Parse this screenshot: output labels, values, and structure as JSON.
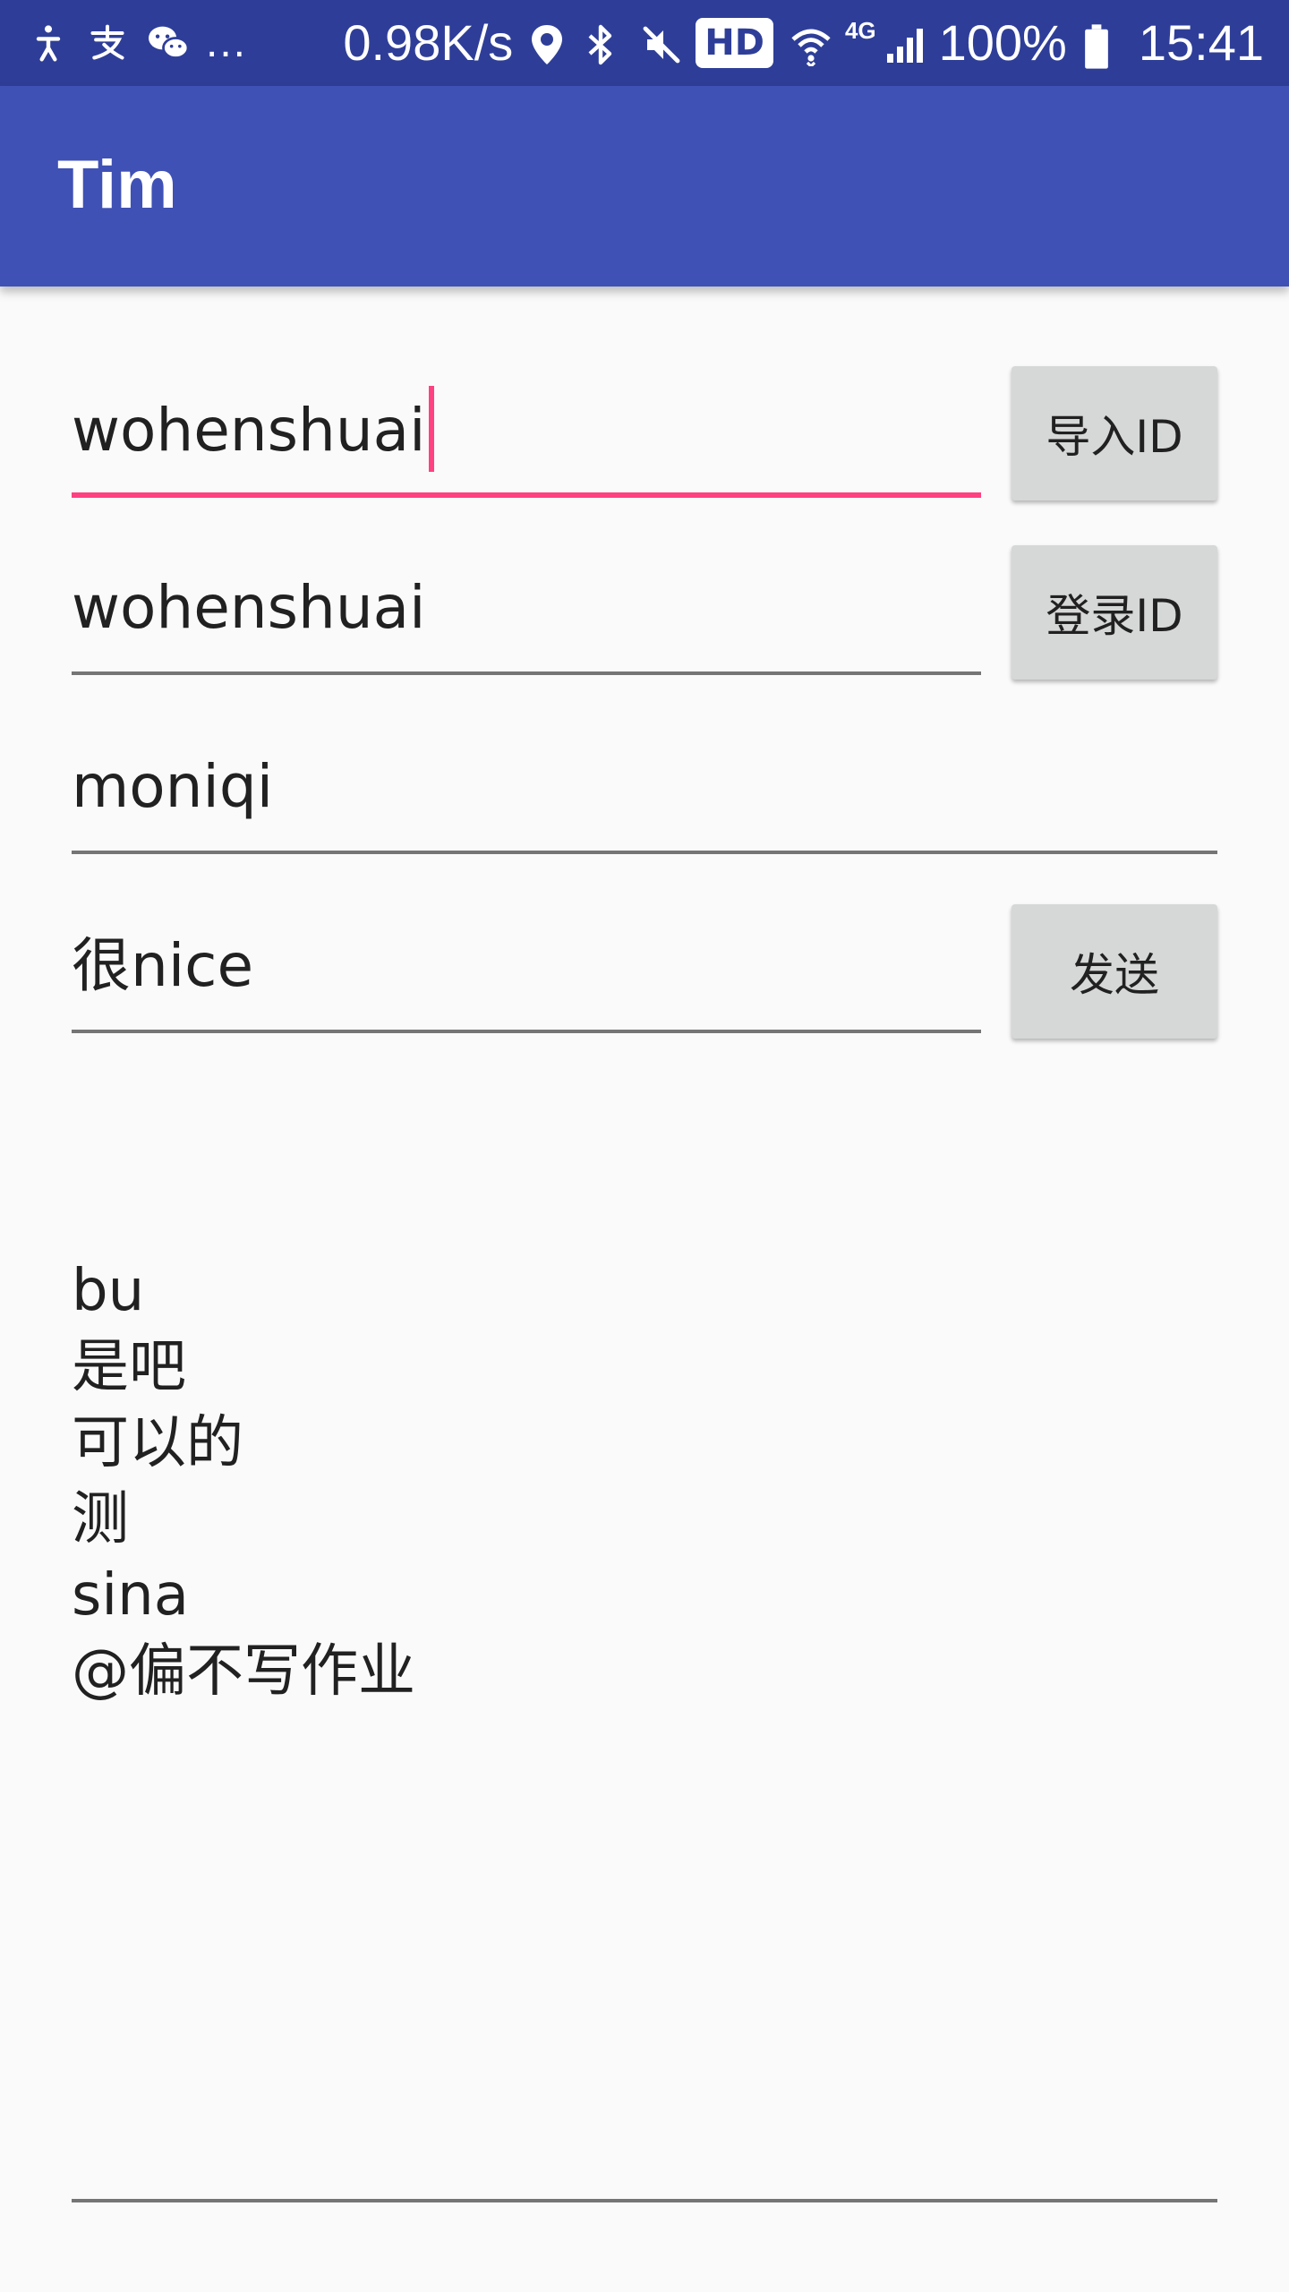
{
  "status_bar": {
    "dots": "...",
    "net_speed": "0.98K/s",
    "hd_label": "HD",
    "network_type": "4G",
    "battery": "100%",
    "time": "15:41"
  },
  "app_bar": {
    "title": "Tim"
  },
  "form": {
    "import_id_value": "wohenshuai",
    "import_id_button": "导入ID",
    "login_id_value": "wohenshuai",
    "login_id_button": "登录ID",
    "peer_value": "moniqi",
    "message_value": "很nice",
    "send_button": "发送"
  },
  "messages": [
    "bu",
    "是吧",
    "可以的",
    "测",
    "sina",
    "@偏不写作业"
  ],
  "colors": {
    "status_bar": "#2e3e98",
    "app_bar": "#3f51b5",
    "accent": "#ff4081",
    "button": "#d6d7d7",
    "background": "#fafafa"
  }
}
